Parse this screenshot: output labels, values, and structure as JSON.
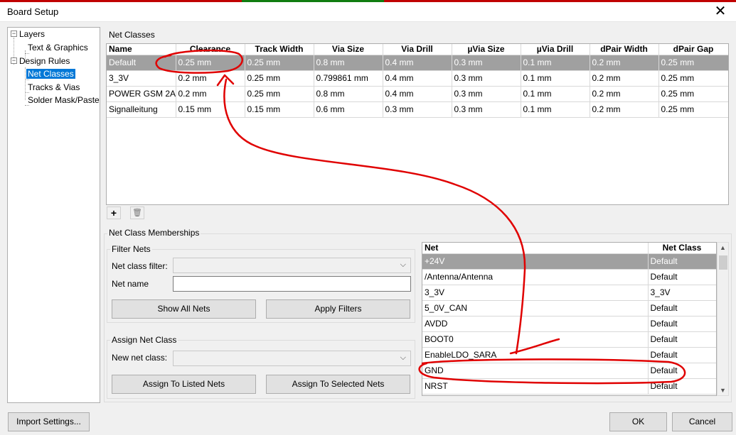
{
  "window": {
    "title": "Board Setup",
    "close_glyph": "✕"
  },
  "tree": {
    "layers": "Layers",
    "text_graphics": "Text & Graphics",
    "design_rules": "Design Rules",
    "net_classes": "Net Classes",
    "tracks_vias": "Tracks & Vias",
    "solder_mask": "Solder Mask/Paste"
  },
  "net_classes": {
    "title": "Net Classes",
    "columns": [
      "Name",
      "Clearance",
      "Track Width",
      "Via Size",
      "Via Drill",
      "µVia Size",
      "µVia Drill",
      "dPair Width",
      "dPair Gap"
    ],
    "rows": [
      [
        "Default",
        "0.25 mm",
        "0.25 mm",
        "0.8 mm",
        "0.4 mm",
        "0.3 mm",
        "0.1 mm",
        "0.2 mm",
        "0.25 mm"
      ],
      [
        "3_3V",
        "0.2 mm",
        "0.25 mm",
        "0.799861 mm",
        "0.4 mm",
        "0.3 mm",
        "0.1 mm",
        "0.2 mm",
        "0.25 mm"
      ],
      [
        "POWER GSM 2A",
        "0.2 mm",
        "0.25 mm",
        "0.8 mm",
        "0.4 mm",
        "0.3 mm",
        "0.1 mm",
        "0.2 mm",
        "0.25 mm"
      ],
      [
        "Signalleitung",
        "0.15 mm",
        "0.15 mm",
        "0.6 mm",
        "0.3 mm",
        "0.3 mm",
        "0.1 mm",
        "0.2 mm",
        "0.25 mm"
      ]
    ],
    "add_glyph": "+",
    "delete_glyph": "🗑"
  },
  "memberships": {
    "title": "Net Class Memberships",
    "filter": {
      "title": "Filter Nets",
      "class_filter_label": "Net class filter:",
      "class_filter_value": "",
      "net_name_label": "Net name",
      "net_name_value": "",
      "show_all": "Show All Nets",
      "apply": "Apply Filters"
    },
    "assign": {
      "title": "Assign Net Class",
      "new_class_label": "New net class:",
      "new_class_value": "",
      "assign_listed": "Assign To Listed Nets",
      "assign_selected": "Assign To Selected Nets"
    },
    "nets": {
      "columns": [
        "Net",
        "Net Class"
      ],
      "rows": [
        [
          "+24V",
          "Default"
        ],
        [
          "/Antenna/Antenna",
          "Default"
        ],
        [
          "3_3V",
          "3_3V"
        ],
        [
          "5_0V_CAN",
          "Default"
        ],
        [
          "AVDD",
          "Default"
        ],
        [
          "BOOT0",
          "Default"
        ],
        [
          "EnableLDO_SARA",
          "Default"
        ],
        [
          "GND",
          "Default"
        ],
        [
          "NRST",
          "Default"
        ]
      ]
    }
  },
  "footer": {
    "import": "Import Settings...",
    "ok": "OK",
    "cancel": "Cancel"
  },
  "colors": {
    "selection": "#0078d7",
    "row_selected": "#a0a0a0",
    "annotation": "#e00000"
  }
}
